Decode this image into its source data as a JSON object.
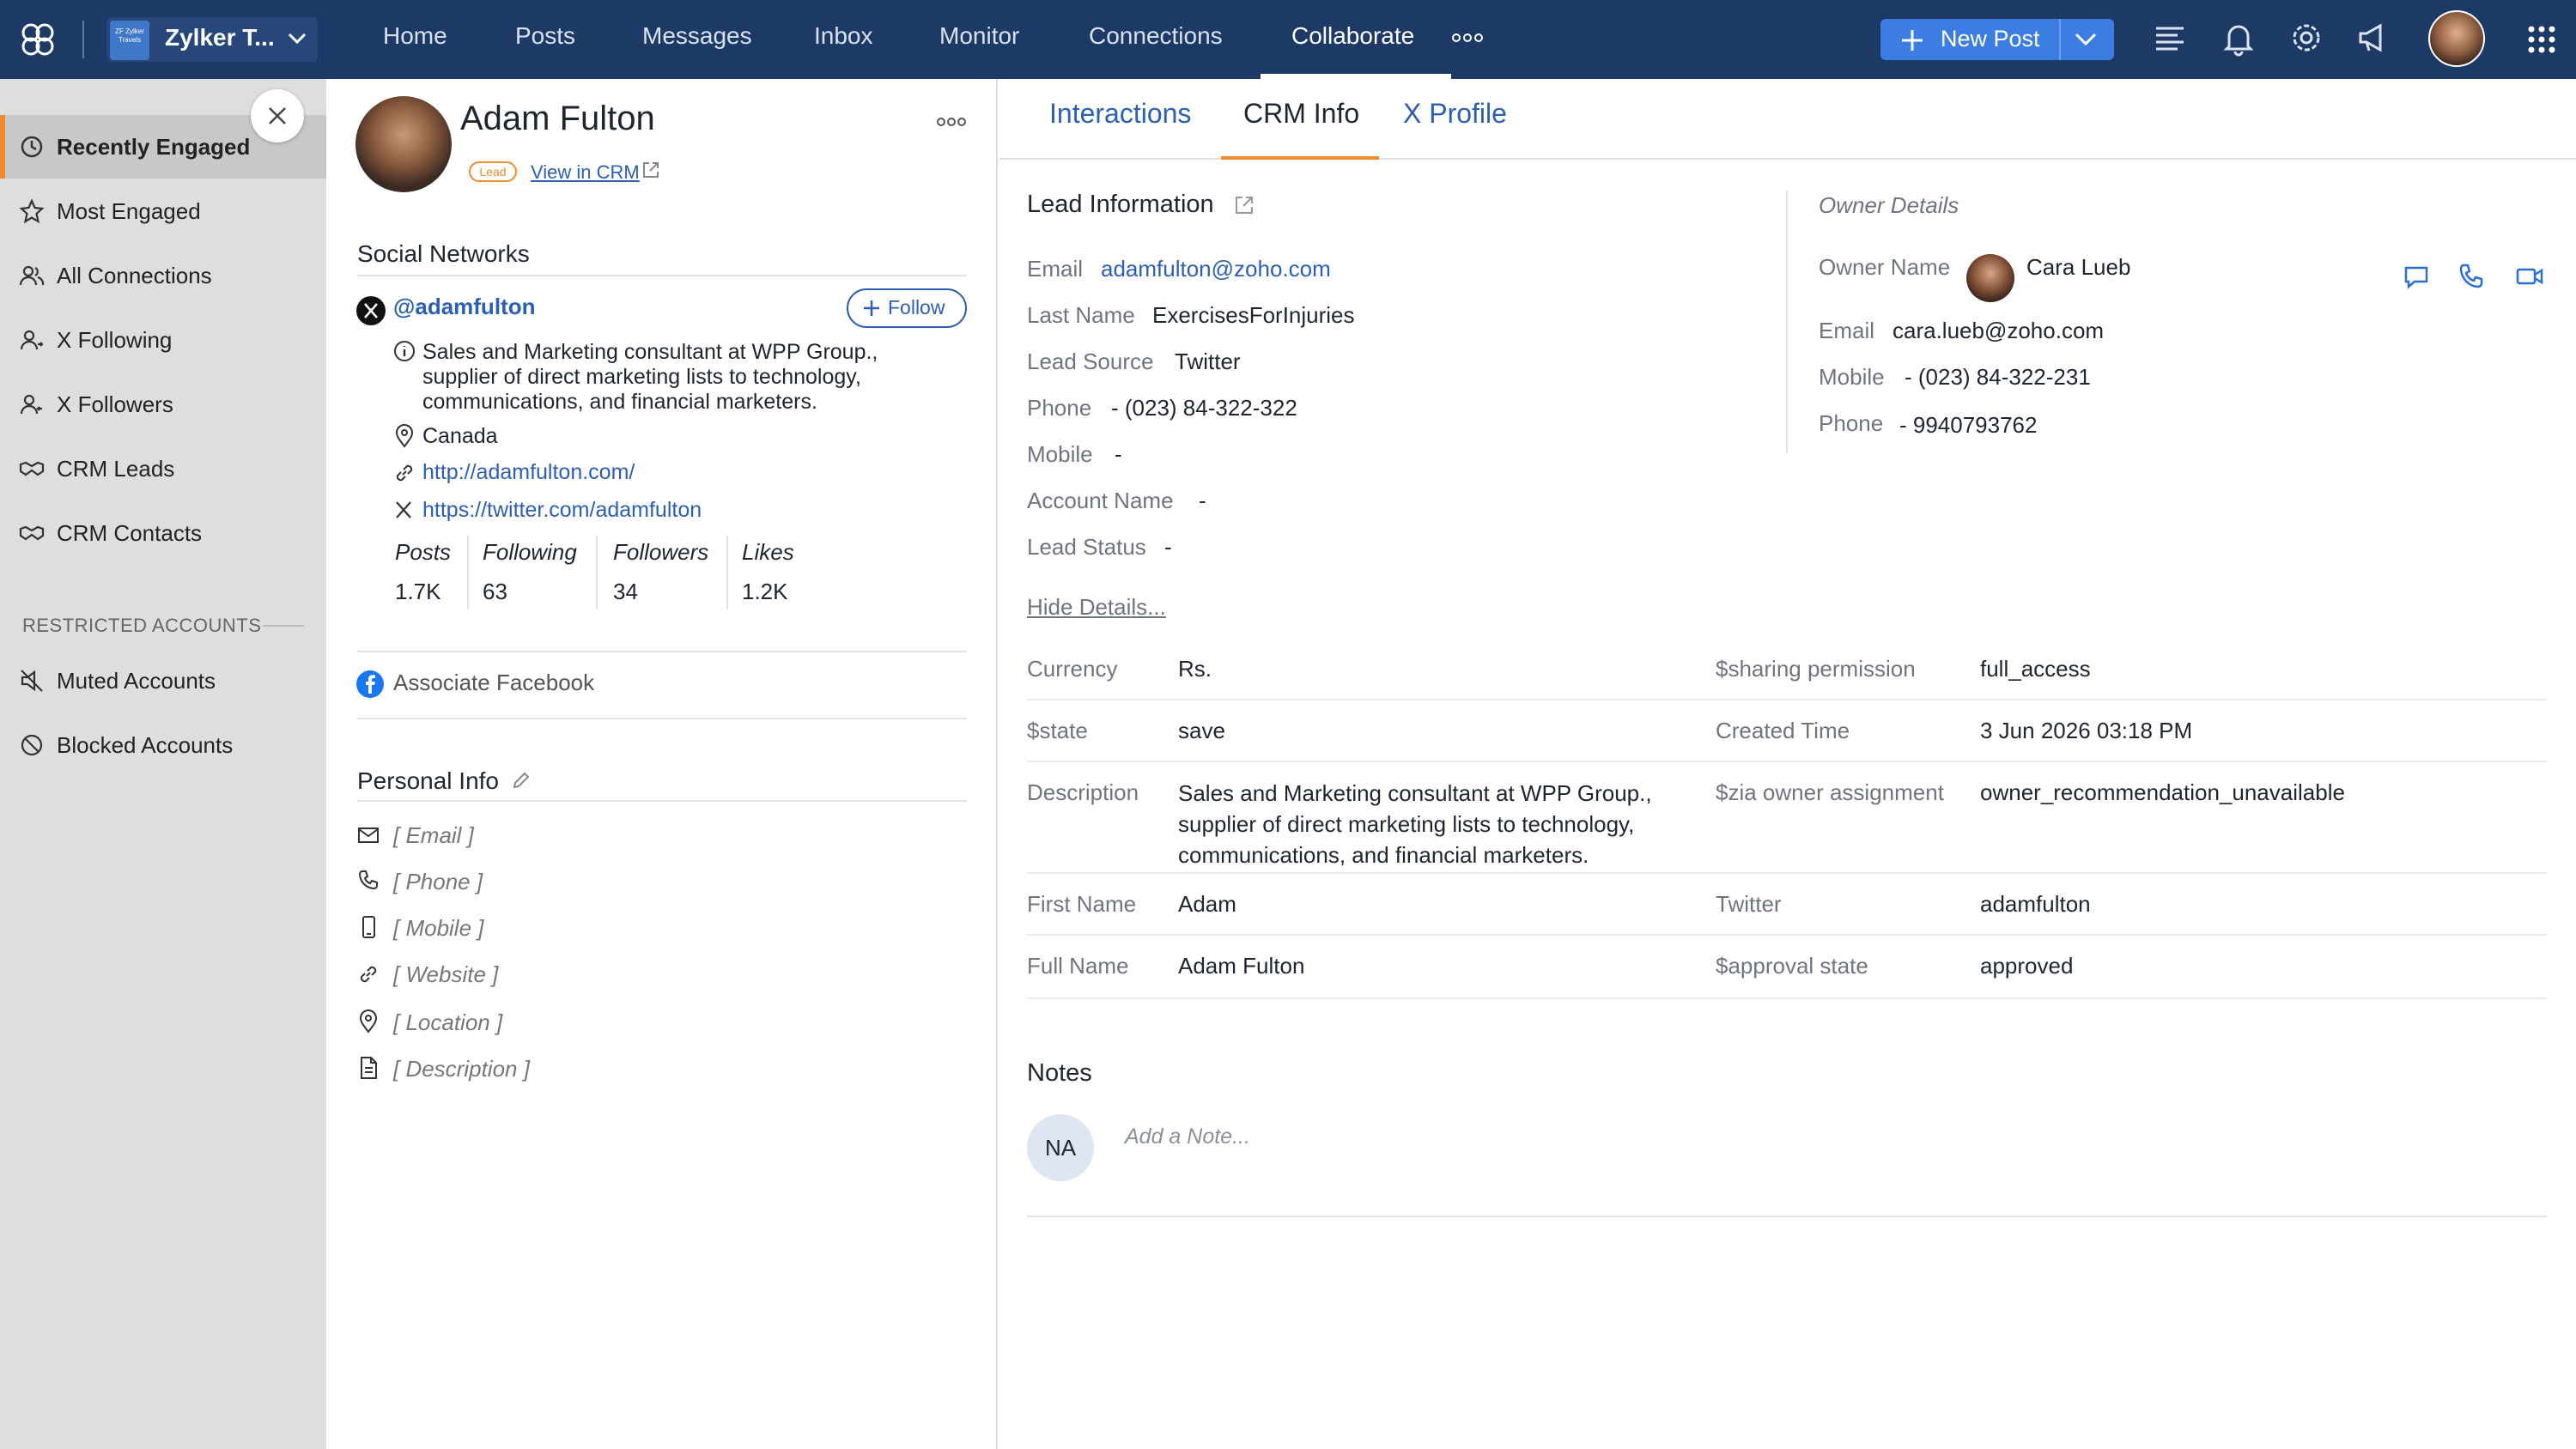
{
  "topbar": {
    "brand_name": "Zylker T...",
    "brand_logo_text": "ZF Zylker Travels",
    "nav": [
      "Home",
      "Posts",
      "Messages",
      "Inbox",
      "Monitor",
      "Connections",
      "Collaborate"
    ],
    "active_nav": "Collaborate",
    "new_post_label": "New Post"
  },
  "sidebar": {
    "items": [
      {
        "label": "Recently Engaged",
        "icon": "history-icon",
        "active": true
      },
      {
        "label": "Most Engaged",
        "icon": "star-icon"
      },
      {
        "label": "All Connections",
        "icon": "users-icon"
      },
      {
        "label": "X Following",
        "icon": "user-follow-icon"
      },
      {
        "label": "X Followers",
        "icon": "user-followers-icon"
      },
      {
        "label": "CRM Leads",
        "icon": "handshake-icon"
      },
      {
        "label": "CRM Contacts",
        "icon": "handshake-icon"
      }
    ],
    "restricted_title": "RESTRICTED ACCOUNTS",
    "restricted_items": [
      {
        "label": "Muted Accounts",
        "icon": "mute-icon"
      },
      {
        "label": "Blocked Accounts",
        "icon": "block-icon"
      }
    ]
  },
  "profile": {
    "name": "Adam Fulton",
    "badge": "Lead",
    "view_crm": "View in CRM",
    "social_title": "Social Networks",
    "handle": "@adamfulton",
    "follow_label": "Follow",
    "bio": "Sales and Marketing consultant at WPP Group., supplier of direct marketing lists to technology, communications, and financial marketers.",
    "location": "Canada",
    "website": "http://adamfulton.com/",
    "twitter_url": "https://twitter.com/adamfulton",
    "stats": [
      {
        "label": "Posts",
        "value": "1.7K"
      },
      {
        "label": "Following",
        "value": "63"
      },
      {
        "label": "Followers",
        "value": "34"
      },
      {
        "label": "Likes",
        "value": "1.2K"
      }
    ],
    "associate_facebook": "Associate Facebook",
    "personal_title": "Personal Info",
    "personal_fields": [
      "[ Email ]",
      "[ Phone ]",
      "[ Mobile ]",
      "[ Website ]",
      "[ Location ]",
      "[ Description ]"
    ]
  },
  "tabs": [
    "Interactions",
    "CRM Info",
    "X Profile"
  ],
  "active_tab": "CRM Info",
  "lead_info": {
    "title": "Lead Information",
    "fields": [
      {
        "label": "Email",
        "value": "adamfulton@zoho.com"
      },
      {
        "label": "Last Name",
        "value": "ExercisesForInjuries"
      },
      {
        "label": "Lead Source",
        "value": "Twitter"
      },
      {
        "label": "Phone",
        "value": "- (023) 84-322-322"
      },
      {
        "label": "Mobile",
        "value": "-"
      },
      {
        "label": "Account Name",
        "value": "-"
      },
      {
        "label": "Lead Status",
        "value": "-"
      }
    ],
    "hide_details": "Hide Details..."
  },
  "owner": {
    "title": "Owner Details",
    "name_label": "Owner Name",
    "name": "Cara Lueb",
    "email_label": "Email",
    "email": "cara.lueb@zoho.com",
    "mobile_label": "Mobile",
    "mobile": "- (023) 84-322-231",
    "phone_label": "Phone",
    "phone": "-   9940793762"
  },
  "details": {
    "left": [
      {
        "label": "Currency",
        "value": "Rs."
      },
      {
        "label": "$state",
        "value": "save"
      },
      {
        "label": "Description",
        "value": "Sales and Marketing consultant at WPP Group., supplier of direct marketing lists to technology, communications, and financial marketers."
      },
      {
        "label": "First Name",
        "value": "Adam"
      },
      {
        "label": "Full Name",
        "value": "Adam Fulton"
      }
    ],
    "right": [
      {
        "label": "$sharing permission",
        "value": "full_access"
      },
      {
        "label": "Created Time",
        "value": "3 Jun 2026 03:18 PM"
      },
      {
        "label": "$zia owner assignment",
        "value": "owner_recommendation_unavailable"
      },
      {
        "label": "Twitter",
        "value": "adamfulton"
      },
      {
        "label": "$approval state",
        "value": "approved"
      }
    ]
  },
  "notes": {
    "title": "Notes",
    "avatar": "NA",
    "placeholder": "Add a Note..."
  }
}
